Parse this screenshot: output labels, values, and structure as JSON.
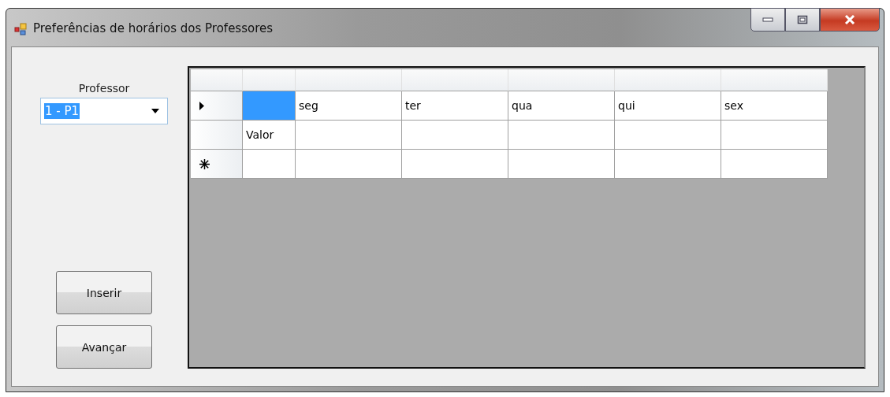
{
  "window": {
    "title": "Preferências de horários dos Professores"
  },
  "professor": {
    "label": "Professor",
    "value": "1 - P1",
    "value_highlighted": true
  },
  "buttons": [
    "Inserir",
    "Avançar"
  ],
  "grid": {
    "rows": [
      {
        "kind": "current",
        "cells": [
          {
            "selected": true
          },
          {
            "text": "seg",
            "selected": false
          },
          {
            "text": "ter",
            "selected": false
          },
          {
            "text": "qua",
            "selected": false
          },
          {
            "text": "qui",
            "selected": false
          },
          {
            "text": "sex",
            "selected": false
          }
        ]
      },
      {
        "kind": "plain",
        "cells": [
          {
            "text": "Valor",
            "selected": false
          },
          {
            "selected": false
          },
          {
            "selected": false
          },
          {
            "selected": false
          },
          {
            "selected": false
          },
          {
            "selected": false
          }
        ]
      },
      {
        "kind": "new",
        "cells": [
          {
            "selected": false
          },
          {
            "selected": false
          },
          {
            "selected": false
          },
          {
            "selected": false
          },
          {
            "selected": false
          },
          {
            "selected": false
          }
        ]
      }
    ]
  }
}
